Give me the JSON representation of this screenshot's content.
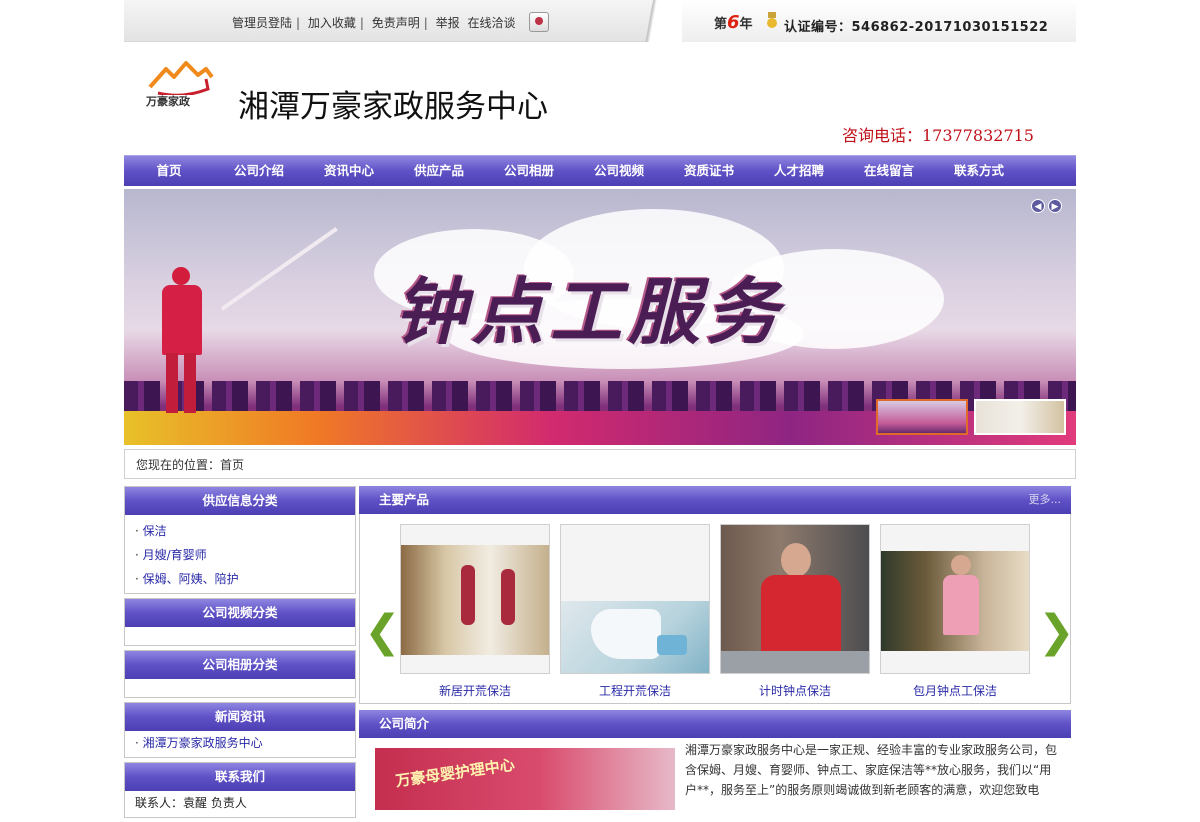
{
  "topbar": {
    "links": [
      "管理员登陆",
      "加入收藏",
      "免责声明",
      "举报"
    ],
    "chat_label": "在线洽谈",
    "year_prefix": "第",
    "year_num": "6",
    "year_suffix": "年",
    "cert_label": "认证编号：546862-20171030151522"
  },
  "header": {
    "logo_text": "万豪家政",
    "site_title": "湘潭万豪家政服务中心",
    "hotline": "咨询电话：17377832715"
  },
  "nav": [
    "首页",
    "公司介绍",
    "资讯中心",
    "供应产品",
    "公司相册",
    "公司视频",
    "资质证书",
    "人才招聘",
    "在线留言",
    "联系方式"
  ],
  "banner": {
    "title": "钟点工服务",
    "thumb_text": "钟点工服务"
  },
  "breadcrumb": "您现在的位置：首页",
  "left": {
    "supply": {
      "title": "供应信息分类",
      "items": [
        "保洁",
        "月嫂/育婴师",
        "保姆、阿姨、陪护"
      ]
    },
    "video": {
      "title": "公司视频分类"
    },
    "album": {
      "title": "公司相册分类"
    },
    "news": {
      "title": "新闻资讯",
      "items": [
        "湘潭万豪家政服务中心"
      ]
    },
    "contact": {
      "title": "联系我们",
      "person": "联系人：袁醒 负责人"
    }
  },
  "products": {
    "title": "主要产品",
    "more": "更多...",
    "items": [
      "新居开荒保洁",
      "工程开荒保洁",
      "计时钟点保洁",
      "包月钟点工保洁"
    ]
  },
  "profile": {
    "title": "公司简介",
    "image_text": "万豪母婴护理中心",
    "text": "湘潭万豪家政服务中心是一家正规、经验丰富的专业家政服务公司，包含保姆、月嫂、育婴师、钟点工、家庭保洁等**放心服务，我们以“用户**，服务至上”的服务原则竭诚做到新老顾客的满意，欢迎您致电"
  }
}
